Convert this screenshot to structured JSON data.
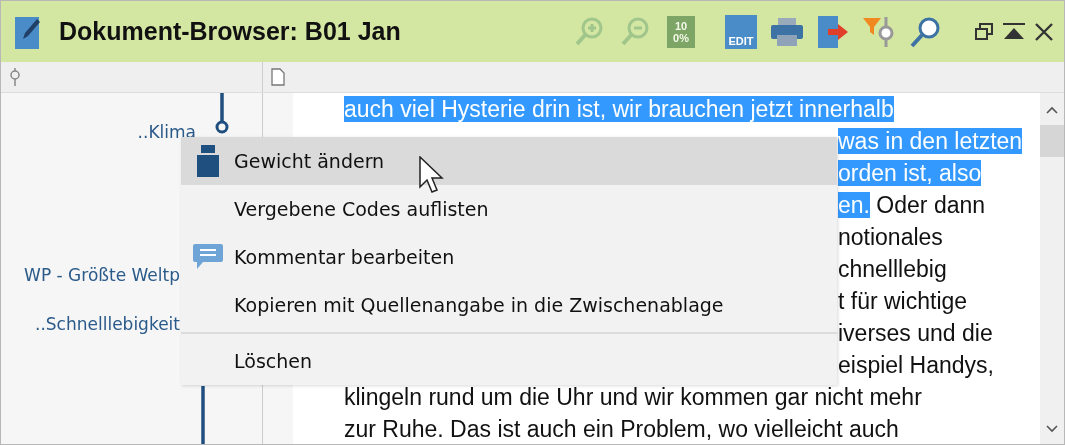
{
  "window": {
    "title": "Dokument-Browser: B01 Jan"
  },
  "toolbar": [
    {
      "kind": "zoom-in",
      "disabled": true
    },
    {
      "kind": "zoom-out",
      "disabled": true
    },
    {
      "kind": "percent",
      "label": "100%",
      "disabled": true
    },
    {
      "kind": "edit",
      "label": "EDIT",
      "disabled": false
    },
    {
      "kind": "print",
      "disabled": false
    },
    {
      "kind": "export",
      "disabled": false
    },
    {
      "kind": "filter",
      "disabled": false
    },
    {
      "kind": "search",
      "disabled": false
    }
  ],
  "tree": [
    {
      "label": "..Klima",
      "node": true
    },
    {
      "label": "WP - Größte Weltp",
      "node": false
    },
    {
      "label": "..Schnelllebigkeit",
      "node": false
    }
  ],
  "document": {
    "lines": [
      {
        "covered": false,
        "segments": [
          {
            "text": "auch viel Hysterie drin ist, wir brauchen jetzt innerhalb",
            "selected": true
          }
        ]
      },
      {
        "covered": true,
        "segments": [
          {
            "text": "was in den letzten",
            "selected": true
          }
        ]
      },
      {
        "covered": true,
        "segments": [
          {
            "text": "orden ist, also",
            "selected": true
          }
        ]
      },
      {
        "covered": true,
        "segments": [
          {
            "text": "en.",
            "selected": true
          },
          {
            "text": " Oder dann",
            "selected": false
          }
        ]
      },
      {
        "covered": true,
        "segments": [
          {
            "text": "notionales",
            "selected": false
          }
        ]
      },
      {
        "covered": true,
        "segments": [
          {
            "text": "chnelllebig",
            "selected": false
          }
        ]
      },
      {
        "covered": true,
        "segments": [
          {
            "text": "t für wichtige",
            "selected": false
          }
        ]
      },
      {
        "covered": true,
        "segments": [
          {
            "text": "iverses und die",
            "selected": false
          }
        ]
      },
      {
        "covered": true,
        "segments": [
          {
            "text": "eispiel Handys,",
            "selected": false
          }
        ]
      },
      {
        "covered": false,
        "segments": [
          {
            "text": "klingeln rund um die Uhr und wir kommen gar nicht mehr",
            "selected": false
          }
        ]
      },
      {
        "covered": false,
        "segments": [
          {
            "text": "zur Ruhe. Das ist auch ein Problem, wo vielleicht auch",
            "selected": false
          }
        ]
      }
    ]
  },
  "context_menu": {
    "items": [
      {
        "kind": "weight",
        "label": "Gewicht ändern",
        "selected": true
      },
      {
        "kind": "plain",
        "label": "Vergebene Codes auflisten",
        "selected": false
      },
      {
        "kind": "comment",
        "label": "Kommentar bearbeiten",
        "selected": false
      },
      {
        "kind": "plain",
        "label": "Kopieren mit Quellenangabe in die Zwischenablage",
        "selected": false
      },
      {
        "kind": "separator"
      },
      {
        "kind": "plain",
        "label": "Löschen",
        "selected": false
      }
    ]
  }
}
